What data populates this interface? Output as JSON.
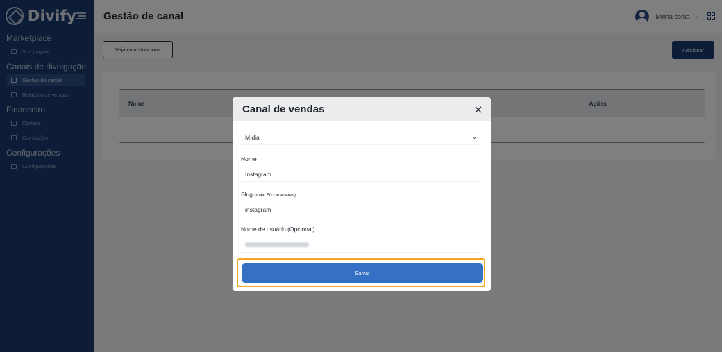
{
  "brand": {
    "name": "Divify"
  },
  "sidebar": {
    "sections": [
      {
        "title": "Marketplace",
        "items": [
          {
            "label": "Sua página",
            "icon": "page-icon"
          }
        ]
      },
      {
        "title": "Canais de divulgação",
        "items": [
          {
            "label": "Gestão de canais",
            "icon": "megaphone-icon",
            "active": true
          },
          {
            "label": "Relatório de vendas",
            "icon": "chart-icon"
          }
        ]
      },
      {
        "title": "Financeiro",
        "items": [
          {
            "label": "Carteira",
            "icon": "wallet-icon"
          },
          {
            "label": "Comissões",
            "icon": "percent-icon"
          }
        ]
      },
      {
        "title": "Configurações",
        "items": [
          {
            "label": "Configurações",
            "icon": "gear-icon"
          }
        ]
      }
    ]
  },
  "header": {
    "title": "Gestão de canal",
    "account_label": "Minha conta"
  },
  "toolbar": {
    "how_it_works": "Veja como funciona",
    "add": "Adicionar"
  },
  "table": {
    "columns": [
      "Nome",
      "Ações"
    ]
  },
  "modal": {
    "title": "Canal de vendas",
    "type_value": "Mídia",
    "name_label": "Nome",
    "name_value": "Instagram",
    "slug_label": "Slug",
    "slug_hint": "(máx. 50 caracteres)",
    "slug_value": "instagram",
    "username_label": "Nome de usuário (Opcional)",
    "save": "Salvar"
  },
  "colors": {
    "sidebar": "#1c3b6e",
    "primary": "#3470c4",
    "highlight": "#f5a623"
  }
}
